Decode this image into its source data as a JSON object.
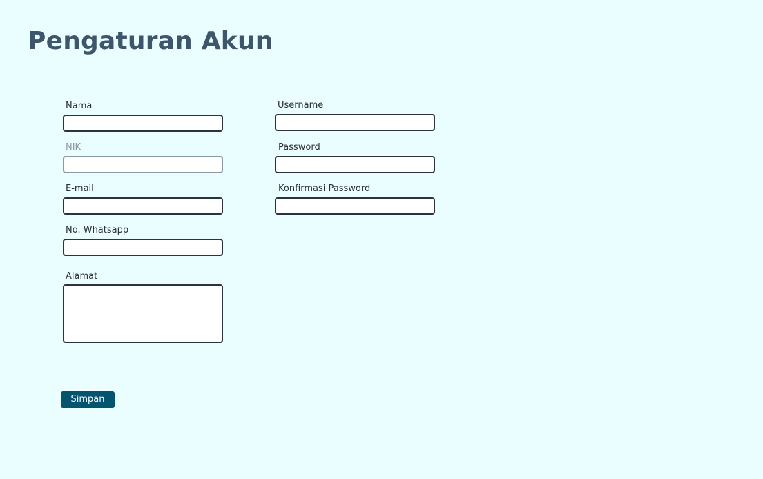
{
  "page": {
    "title": "Pengaturan Akun"
  },
  "form": {
    "left": {
      "nama": {
        "label": "Nama",
        "value": ""
      },
      "nik": {
        "label": "NIK",
        "value": ""
      },
      "email": {
        "label": "E-mail",
        "value": ""
      },
      "whatsapp": {
        "label": "No. Whatsapp",
        "value": ""
      },
      "alamat": {
        "label": "Alamat",
        "value": ""
      }
    },
    "right": {
      "username": {
        "label": "Username",
        "value": ""
      },
      "password": {
        "label": "Password",
        "value": ""
      },
      "confirm_password": {
        "label": "Konfirmasi Password",
        "value": ""
      }
    },
    "save_label": "Simpan"
  },
  "colors": {
    "background": "#ebfeff",
    "title": "#3e566b",
    "button": "#05546f",
    "input_border": "#2b3340",
    "disabled_border": "#8a9aa2"
  }
}
